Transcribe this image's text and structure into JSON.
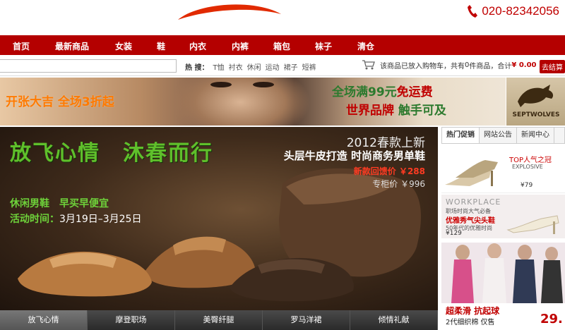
{
  "header": {
    "phone": "020-82342056"
  },
  "nav": {
    "items": [
      "首页",
      "最新商品",
      "女装",
      "鞋",
      "内衣",
      "内裤",
      "箱包",
      "袜子",
      "清仓"
    ]
  },
  "subbar": {
    "hot_label": "热 搜：",
    "hot_terms": [
      "T恤",
      "衬衣",
      "休闲",
      "运动",
      "裙子",
      "短裤"
    ],
    "cart_text": "该商品已放入购物车，共有",
    "cart_count": "0",
    "cart_text2": "件商品，合计",
    "cart_total": "¥ 0.00",
    "checkout": "去结算"
  },
  "top_banner": {
    "promo_left": "开张大吉 全场3折起",
    "promo_right_line1_a": "全场满99元",
    "promo_right_line1_b": "免运费",
    "promo_right_line2_a": "世界品牌",
    "promo_right_line2_b": "触手可及",
    "brand": "SEPTWOLVES"
  },
  "hero": {
    "title": "放飞心情　沐春而行",
    "line1": "2012春款上新",
    "line2": "头层牛皮打造 时尚商务男单鞋",
    "line3": "新款回馈价 ￥288",
    "line4": "专柜价 ￥996",
    "left1": "休闲男鞋　早买早便宜",
    "left2_label": "活动时间：",
    "left2_value": "3月19日–3月25日"
  },
  "hero_tabs": [
    "放飞心情",
    "摩登职场",
    "美臀纤腿",
    "罗马洋裙",
    "倾情礼献"
  ],
  "sidebar": {
    "tabs": [
      "热门促销",
      "网站公告",
      "新闻中心"
    ],
    "ad1_title": "TOP人气之冠",
    "ad1_sub": "EXPLOSIVE",
    "ad1_price": "¥79",
    "ad2_title": "WORKPLACE",
    "ad2_line1": "职场时尚大气必备",
    "ad2_line2": "优雅秀气尖头鞋",
    "ad2_line3": "50年代的优雅时尚",
    "ad2_price": "¥129",
    "ad3_line1": "超柔滑 抗起球",
    "ad3_line2": "2代细织棉 仅售",
    "ad3_price": "29."
  },
  "colors": {
    "nav_red": "#b40000",
    "accent_red": "#c00000",
    "hero_green": "#5fbf2b"
  }
}
